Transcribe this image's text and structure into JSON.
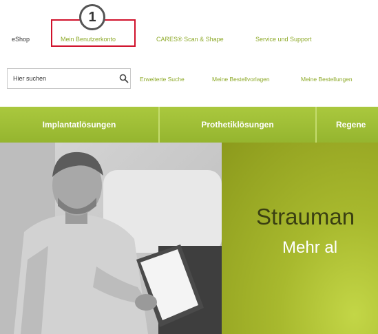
{
  "callout": {
    "number": "1"
  },
  "topnav": {
    "eshop": "eShop",
    "account": "Mein Benutzerkonto",
    "cares": "CARES® Scan & Shape",
    "service": "Service und Support"
  },
  "search": {
    "placeholder": "Hier suchen",
    "links": [
      "Erweiterte Suche",
      "Meine Bestellvorlagen",
      "Meine Bestellungen"
    ]
  },
  "categories": [
    "Implantatlösungen",
    "Prothetiklösungen",
    "Regene"
  ],
  "hero": {
    "title": "Strauman",
    "subtitle": "Mehr al"
  },
  "colors": {
    "accent_green": "#9bbb32",
    "highlight_red": "#d0112b"
  }
}
